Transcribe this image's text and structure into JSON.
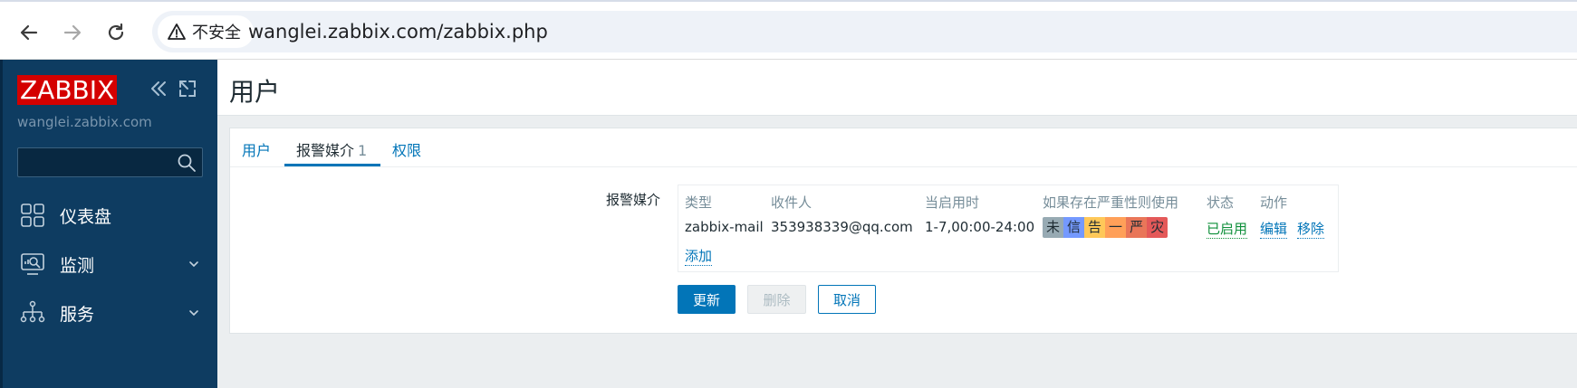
{
  "browser": {
    "security_label": "不安全",
    "url": "wanglei.zabbix.com/zabbix.php"
  },
  "sidebar": {
    "logo": "ZABBIX",
    "server_name": "wanglei.zabbix.com",
    "search_placeholder": "",
    "items": [
      {
        "label": "仪表盘",
        "icon": "dashboard-icon"
      },
      {
        "label": "监测",
        "icon": "monitoring-icon"
      },
      {
        "label": "服务",
        "icon": "services-icon"
      }
    ]
  },
  "header": {
    "title": "用户"
  },
  "tabs": [
    {
      "label": "用户"
    },
    {
      "label": "报警媒介",
      "count": "1"
    },
    {
      "label": "权限"
    }
  ],
  "media": {
    "field_label": "报警媒介",
    "columns": [
      "类型",
      "收件人",
      "当启用时",
      "如果存在严重性则使用",
      "状态",
      "动作"
    ],
    "rows": [
      {
        "type": "zabbix-mail",
        "recipient": "353938339@qq.com",
        "when_active": "1-7,00:00-24:00",
        "severities": [
          {
            "label": "未",
            "color": "#97aab3"
          },
          {
            "label": "信",
            "color": "#7499ff"
          },
          {
            "label": "告",
            "color": "#ffc859"
          },
          {
            "label": "一",
            "color": "#ffa059"
          },
          {
            "label": "严",
            "color": "#e97659"
          },
          {
            "label": "灾",
            "color": "#e45959"
          }
        ],
        "status": "已启用",
        "edit": "编辑",
        "remove": "移除"
      }
    ],
    "add_label": "添加"
  },
  "buttons": {
    "update": "更新",
    "delete": "删除",
    "cancel": "取消"
  },
  "colors": {
    "sidebar_bg": "#0e3c61",
    "accent": "#0275b8",
    "logo_bg": "#d40000",
    "status_enabled": "#0e8f3a"
  }
}
